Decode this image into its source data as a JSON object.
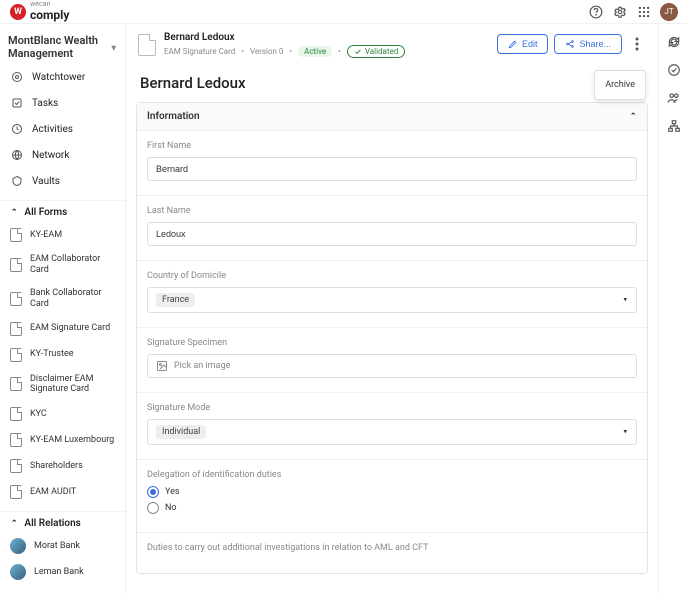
{
  "brand": {
    "super": "wecan",
    "name": "comply",
    "mark": "W"
  },
  "user": {
    "initials": "JT"
  },
  "org": {
    "name": "MontBlanc Wealth Management"
  },
  "nav": {
    "items": [
      {
        "label": "Watchtower"
      },
      {
        "label": "Tasks"
      },
      {
        "label": "Activities"
      },
      {
        "label": "Network"
      },
      {
        "label": "Vaults"
      }
    ],
    "allFormsLabel": "All Forms",
    "forms": [
      {
        "label": "KY-EAM"
      },
      {
        "label": "EAM Collaborator Card"
      },
      {
        "label": "Bank Collaborator Card"
      },
      {
        "label": "EAM Signature Card"
      },
      {
        "label": "KY-Trustee"
      },
      {
        "label": "Disclaimer EAM Signature Card"
      },
      {
        "label": "KYC"
      },
      {
        "label": "KY-EAM Luxembourg"
      },
      {
        "label": "Shareholders"
      },
      {
        "label": "EAM AUDIT"
      }
    ],
    "allRelationsLabel": "All Relations",
    "relations": [
      {
        "label": "Morat Bank"
      },
      {
        "label": "Leman Bank"
      }
    ]
  },
  "header": {
    "title": "Bernard Ledoux",
    "subtitle": "EAM Signature Card",
    "version": "Version 0",
    "status_active": "Active",
    "status_valid": "Validated",
    "edit": "Edit",
    "share": "Share...",
    "menu": {
      "archive": "Archive"
    }
  },
  "page": {
    "title": "Bernard Ledoux",
    "section_info": "Information",
    "fields": {
      "firstNameLabel": "First Name",
      "firstName": "Bernard",
      "lastNameLabel": "Last Name",
      "lastName": "Ledoux",
      "countryLabel": "Country of Domicile",
      "country": "France",
      "specimenLabel": "Signature Specimen",
      "specimenPlaceholder": "Pick an image",
      "modeLabel": "Signature Mode",
      "mode": "Individual",
      "delegationLabel": "Delegation of identification duties",
      "yes": "Yes",
      "no": "No",
      "dutiesLabel": "Duties to carry out additional investigations in relation to AML and CFT"
    }
  }
}
